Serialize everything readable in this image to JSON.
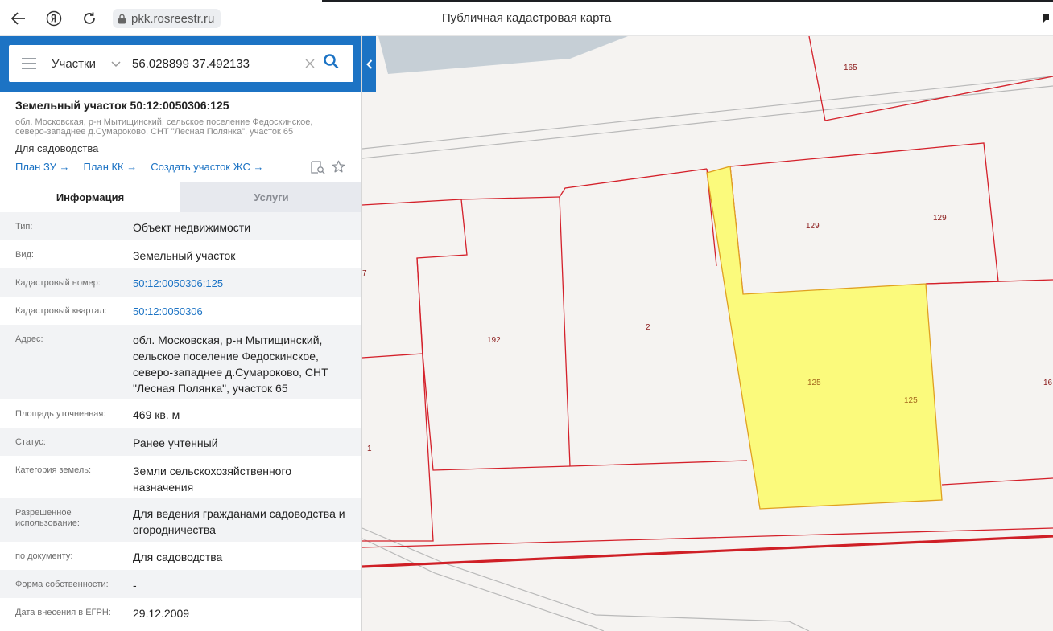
{
  "browser": {
    "url": "pkk.rosreestr.ru",
    "page_title": "Публичная кадастровая карта"
  },
  "search": {
    "type_label": "Участки",
    "query": "56.028899 37.492133"
  },
  "parcel": {
    "title": "Земельный участок 50:12:0050306:125",
    "address_short": "обл. Московская, р-н Мытищинский, сельское поселение Федоскинское, северо-западнее д.Сумароково, СНТ \"Лесная Полянка\", участок 65",
    "use": "Для садоводства",
    "links": [
      "План ЗУ →",
      "План КК →",
      "Создать участок ЖС →"
    ]
  },
  "tabs": {
    "info": "Информация",
    "services": "Услуги"
  },
  "info_rows": [
    {
      "label": "Тип:",
      "value": "Объект недвижимости"
    },
    {
      "label": "Вид:",
      "value": "Земельный участок"
    },
    {
      "label": "Кадастровый номер:",
      "value": "50:12:0050306:125"
    },
    {
      "label": "Кадастровый квартал:",
      "value": "50:12:0050306"
    },
    {
      "label": "Адрес:",
      "value": "обл. Московская, р-н Мытищинский, сельское поселение Федоскинское, северо-западнее д.Сумароково, СНТ \"Лесная Полянка\", участок 65"
    },
    {
      "label": "Площадь уточненная:",
      "value": "469 кв. м"
    },
    {
      "label": "Статус:",
      "value": "Ранее учтенный"
    },
    {
      "label": "Категория земель:",
      "value": "Земли сельскохозяйственного назначения"
    },
    {
      "label": "Разрешенное использование:",
      "value": "Для ведения гражданами садоводства и огородничества"
    },
    {
      "label": "по документу:",
      "value": "Для садоводства"
    },
    {
      "label": "Форма собственности:",
      "value": "-"
    },
    {
      "label": "Дата внесения в ЕГРН:",
      "value": "29.12.2009"
    }
  ],
  "map": {
    "lot_labels": [
      "165",
      "129",
      "129",
      "192",
      "2",
      "125",
      "125",
      "7",
      "1",
      "16"
    ],
    "colors": {
      "boundary": "#d4202a",
      "selected_fill": "#fbfa7c",
      "selected_stroke": "#e0a020",
      "water": "#c6cfd6",
      "road": "#b9b9b9"
    }
  },
  "colors": {
    "accent": "#1c73c4",
    "tab_inactive": "#e7e9ee"
  }
}
